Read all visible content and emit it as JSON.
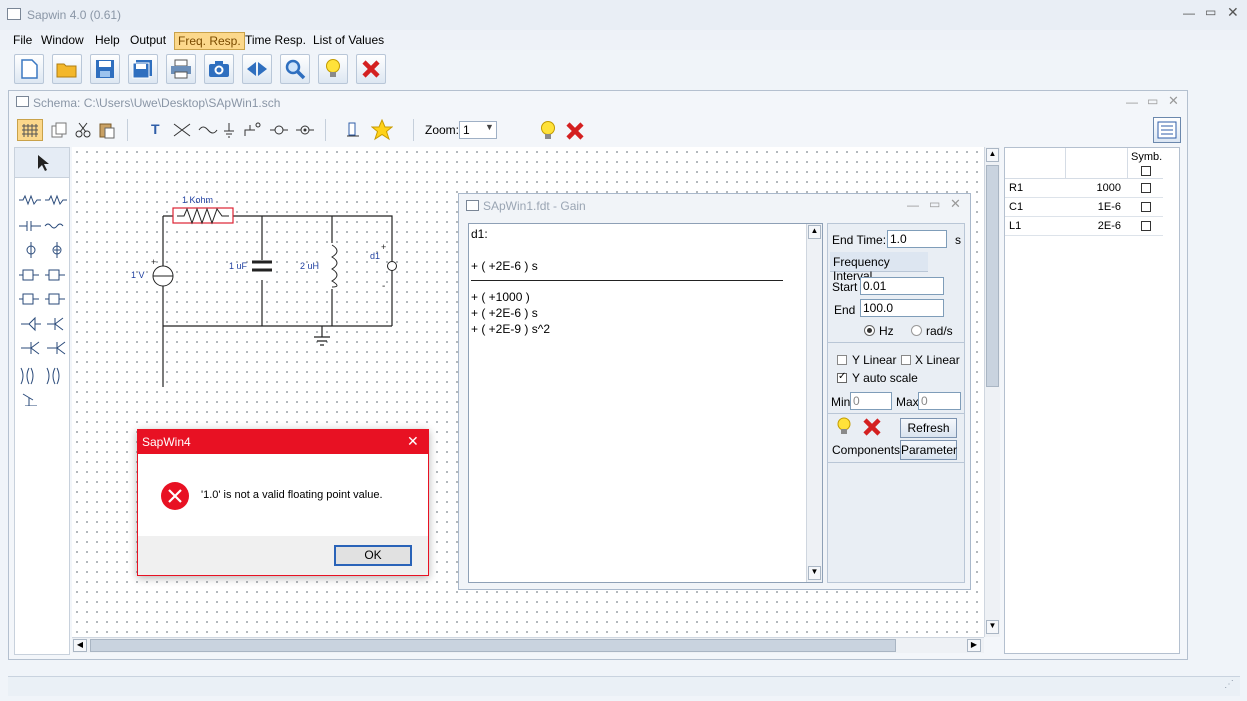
{
  "app": {
    "title": "Sapwin 4.0 (0.61)"
  },
  "menu": {
    "items": [
      "File",
      "Window",
      "Help",
      "Output",
      "Freq. Resp.",
      "Time Resp.",
      "List of Values"
    ],
    "active": "Freq. Resp."
  },
  "toolbar": {
    "icons": [
      "new-file-icon",
      "open-folder-icon",
      "save-icon",
      "save-all-icon",
      "print-icon",
      "camera-icon",
      "split-arrows-icon",
      "search-icon",
      "bulb-icon",
      "close-x-icon"
    ]
  },
  "schema": {
    "title": "Schema: C:\\Users\\Uwe\\Desktop\\SApWin1.sch",
    "zoom_label": "Zoom:",
    "zoom_value": "1",
    "circuit": {
      "resistor": "1 Kohm",
      "capacitor": "1 uF",
      "inductor": "2 uH",
      "source": "1 V",
      "detector": "d1",
      "plus": "+",
      "minus": "-"
    }
  },
  "symbols": {
    "header": "Symb.",
    "rows": [
      {
        "name": "R1",
        "value": "1000"
      },
      {
        "name": "C1",
        "value": "1E-6"
      },
      {
        "name": "L1",
        "value": "2E-6"
      }
    ]
  },
  "gain": {
    "title": "SApWin1.fdt - Gain",
    "expr": {
      "label": "d1:",
      "numerator": [
        "+ ( +2E-6 ) s"
      ],
      "denominator": [
        "+ ( +1000 )",
        "+ ( +2E-6 ) s",
        "+ ( +2E-9 ) s^2"
      ]
    },
    "end_time_label": "End Time:",
    "end_time_value": "1.0",
    "end_time_unit": "s",
    "freq_interval": "Frequency Interval",
    "start_label": "Start",
    "start_value": "0.01",
    "end_label": "End",
    "end_value": "100.0",
    "hz_label": "Hz",
    "rads_label": "rad/s",
    "ylinear": "Y Linear",
    "xlinear": "X Linear",
    "yauto": "Y auto scale",
    "min_label": "Min",
    "min_value": "0",
    "max_label": "Max",
    "max_value": "0",
    "refresh": "Refresh",
    "components": "Components",
    "parameter": "Parameter"
  },
  "dialog": {
    "title": "SapWin4",
    "message": "'1.0' is not a valid floating point value.",
    "ok": "OK"
  },
  "colors": {
    "accent": "#fcd88b",
    "error": "#e81123"
  }
}
